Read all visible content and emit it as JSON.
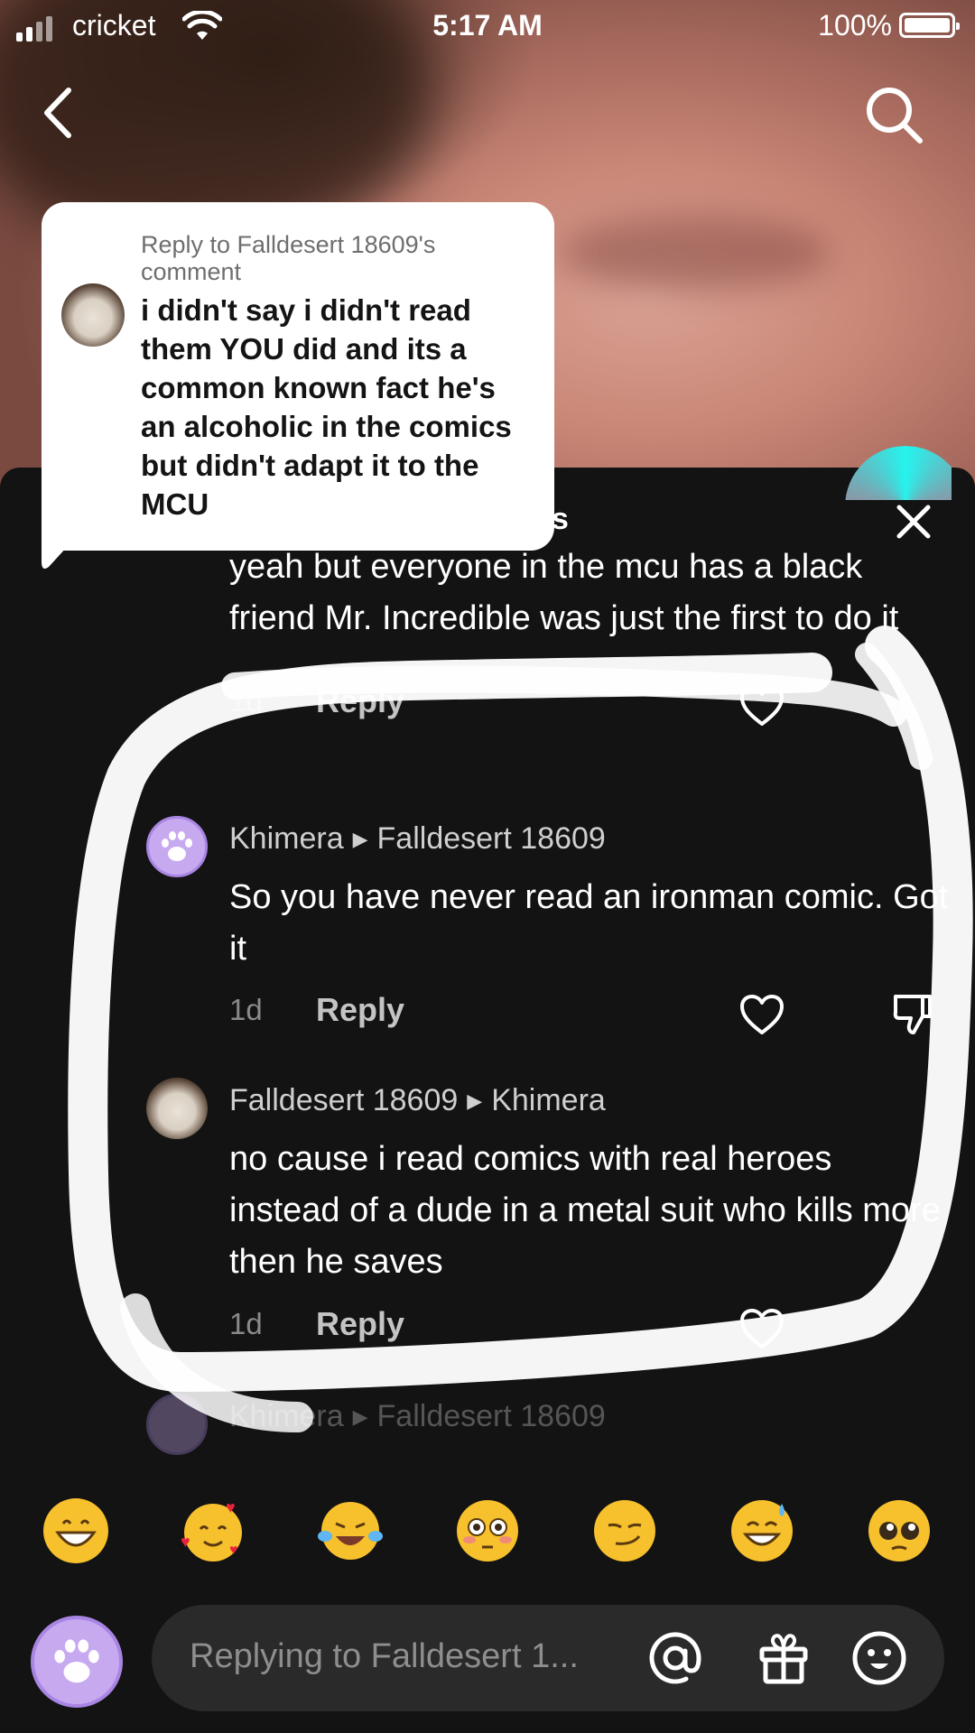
{
  "status_bar": {
    "carrier": "cricket",
    "time": "5:17 AM",
    "battery": "100%"
  },
  "panel": {
    "title_visible": "ents"
  },
  "sticker": {
    "caption": "Reply to Falldesert 18609's comment",
    "text": "i didn't say i didn't read them YOU did and its a common known fact he's an alcoholic in the comics but didn't adapt it to the MCU"
  },
  "comments": [
    {
      "text": "yeah but everyone in the mcu has a black friend Mr. Incredible was just the first to do it",
      "age": "1d",
      "reply": "Reply"
    },
    {
      "author": "Khimera",
      "reply_to": "Falldesert 18609",
      "text": "So you have never read an ironman comic. Got it",
      "age": "1d",
      "reply": "Reply"
    },
    {
      "author": "Falldesert 18609",
      "reply_to": "Khimera",
      "text": "no cause i read comics with real heroes instead of a dude in a metal suit who kills more then he saves",
      "age": "1d",
      "reply": "Reply"
    },
    {
      "author": "Khimera",
      "reply_to": "Falldesert 18609"
    }
  ],
  "emojis": [
    "grinning",
    "smiling-hearts",
    "tears-of-joy",
    "flushed",
    "smirk",
    "sweat-smile",
    "pleading"
  ],
  "input": {
    "placeholder": "Replying to Falldesert 1..."
  },
  "colors": {
    "panel_bg": "#131313",
    "accent_purple": "#c7a9f0",
    "marker": "#ffffff"
  }
}
